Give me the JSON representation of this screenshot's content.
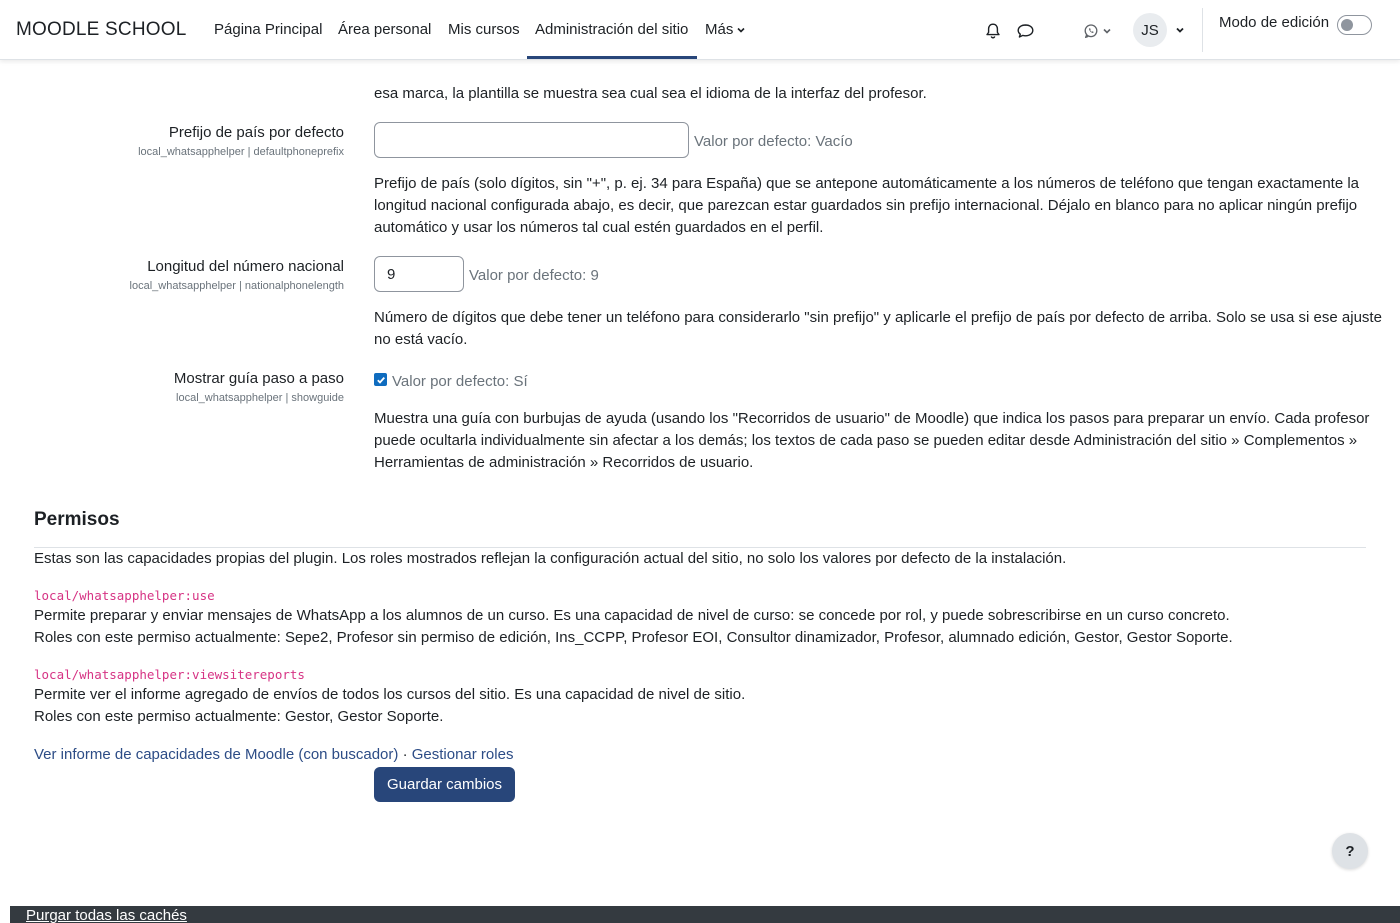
{
  "navbar": {
    "brand": "MOODLE SCHOOL",
    "items": [
      {
        "label": "Página Principal"
      },
      {
        "label": "Área personal"
      },
      {
        "label": "Mis cursos"
      },
      {
        "label": "Administración del sitio"
      },
      {
        "label": "Más"
      }
    ],
    "avatar_initials": "JS",
    "edit_mode_label": "Modo de edición",
    "edit_mode_on": false
  },
  "settings": {
    "intro_tail": "esa marca, la plantilla se muestra sea cual sea el idioma de la interfaz del profesor.",
    "prefix": {
      "label": "Prefijo de país por defecto",
      "key": "local_whatsapphelper | defaultphoneprefix",
      "value": "",
      "default": "Valor por defecto: Vacío",
      "desc1": "Prefijo de país (solo dígitos, sin \"+\", p. ej. 34 para España) que se antepone automáticamente a los números de teléfono que tengan exactamente la",
      "desc2": "longitud nacional configurada abajo, es decir, que parezcan estar guardados sin prefijo internacional. Déjalo en blanco para no aplicar ningún prefijo",
      "desc3": "automático y usar los números tal cual estén guardados en el perfil."
    },
    "length": {
      "label": "Longitud del número nacional",
      "key": "local_whatsapphelper | nationalphonelength",
      "value": "9",
      "default": "Valor por defecto: 9",
      "desc1": "Número de dígitos que debe tener un teléfono para considerarlo \"sin prefijo\" y aplicarle el prefijo de país por defecto de arriba. Solo se usa si ese ajuste",
      "desc2": "no está vacío."
    },
    "guide": {
      "label": "Mostrar guía paso a paso",
      "key": "local_whatsapphelper | showguide",
      "checked": true,
      "default": "Valor por defecto: Sí",
      "desc1": "Muestra una guía con burbujas de ayuda (usando los \"Recorridos de usuario\" de Moodle) que indica los pasos para preparar un envío. Cada profesor",
      "desc2": "puede ocultarla individualmente sin afectar a los demás; los textos de cada paso se pueden editar desde Administración del sitio » Complementos »",
      "desc3": "Herramientas de administración » Recorridos de usuario."
    }
  },
  "permissions": {
    "heading": "Permisos",
    "intro": "Estas son las capacidades propias del plugin. Los roles mostrados reflejan la configuración actual del sitio, no solo los valores por defecto de la instalación.",
    "caps": [
      {
        "name": "local/whatsapphelper:use",
        "desc": "Permite preparar y enviar mensajes de WhatsApp a los alumnos de un curso. Es una capacidad de nivel de curso: se concede por rol, y puede sobrescribirse en un curso concreto.",
        "roles": "Roles con este permiso actualmente: Sepe2, Profesor sin permiso de edición, Ins_CCPP, Profesor EOI, Consultor dinamizador, Profesor, alumnado edición, Gestor, Gestor Soporte."
      },
      {
        "name": "local/whatsapphelper:viewsitereports",
        "desc": "Permite ver el informe agregado de envíos de todos los cursos del sitio. Es una capacidad de nivel de sitio.",
        "roles": "Roles con este permiso actualmente: Gestor, Gestor Soporte."
      }
    ],
    "link1": "Ver informe de capacidades de Moodle (con buscador)",
    "separator": "·",
    "link2": "Gestionar roles"
  },
  "save_label": "Guardar cambios",
  "help_label": "?",
  "footer_link": "Purgar todas las cachés"
}
